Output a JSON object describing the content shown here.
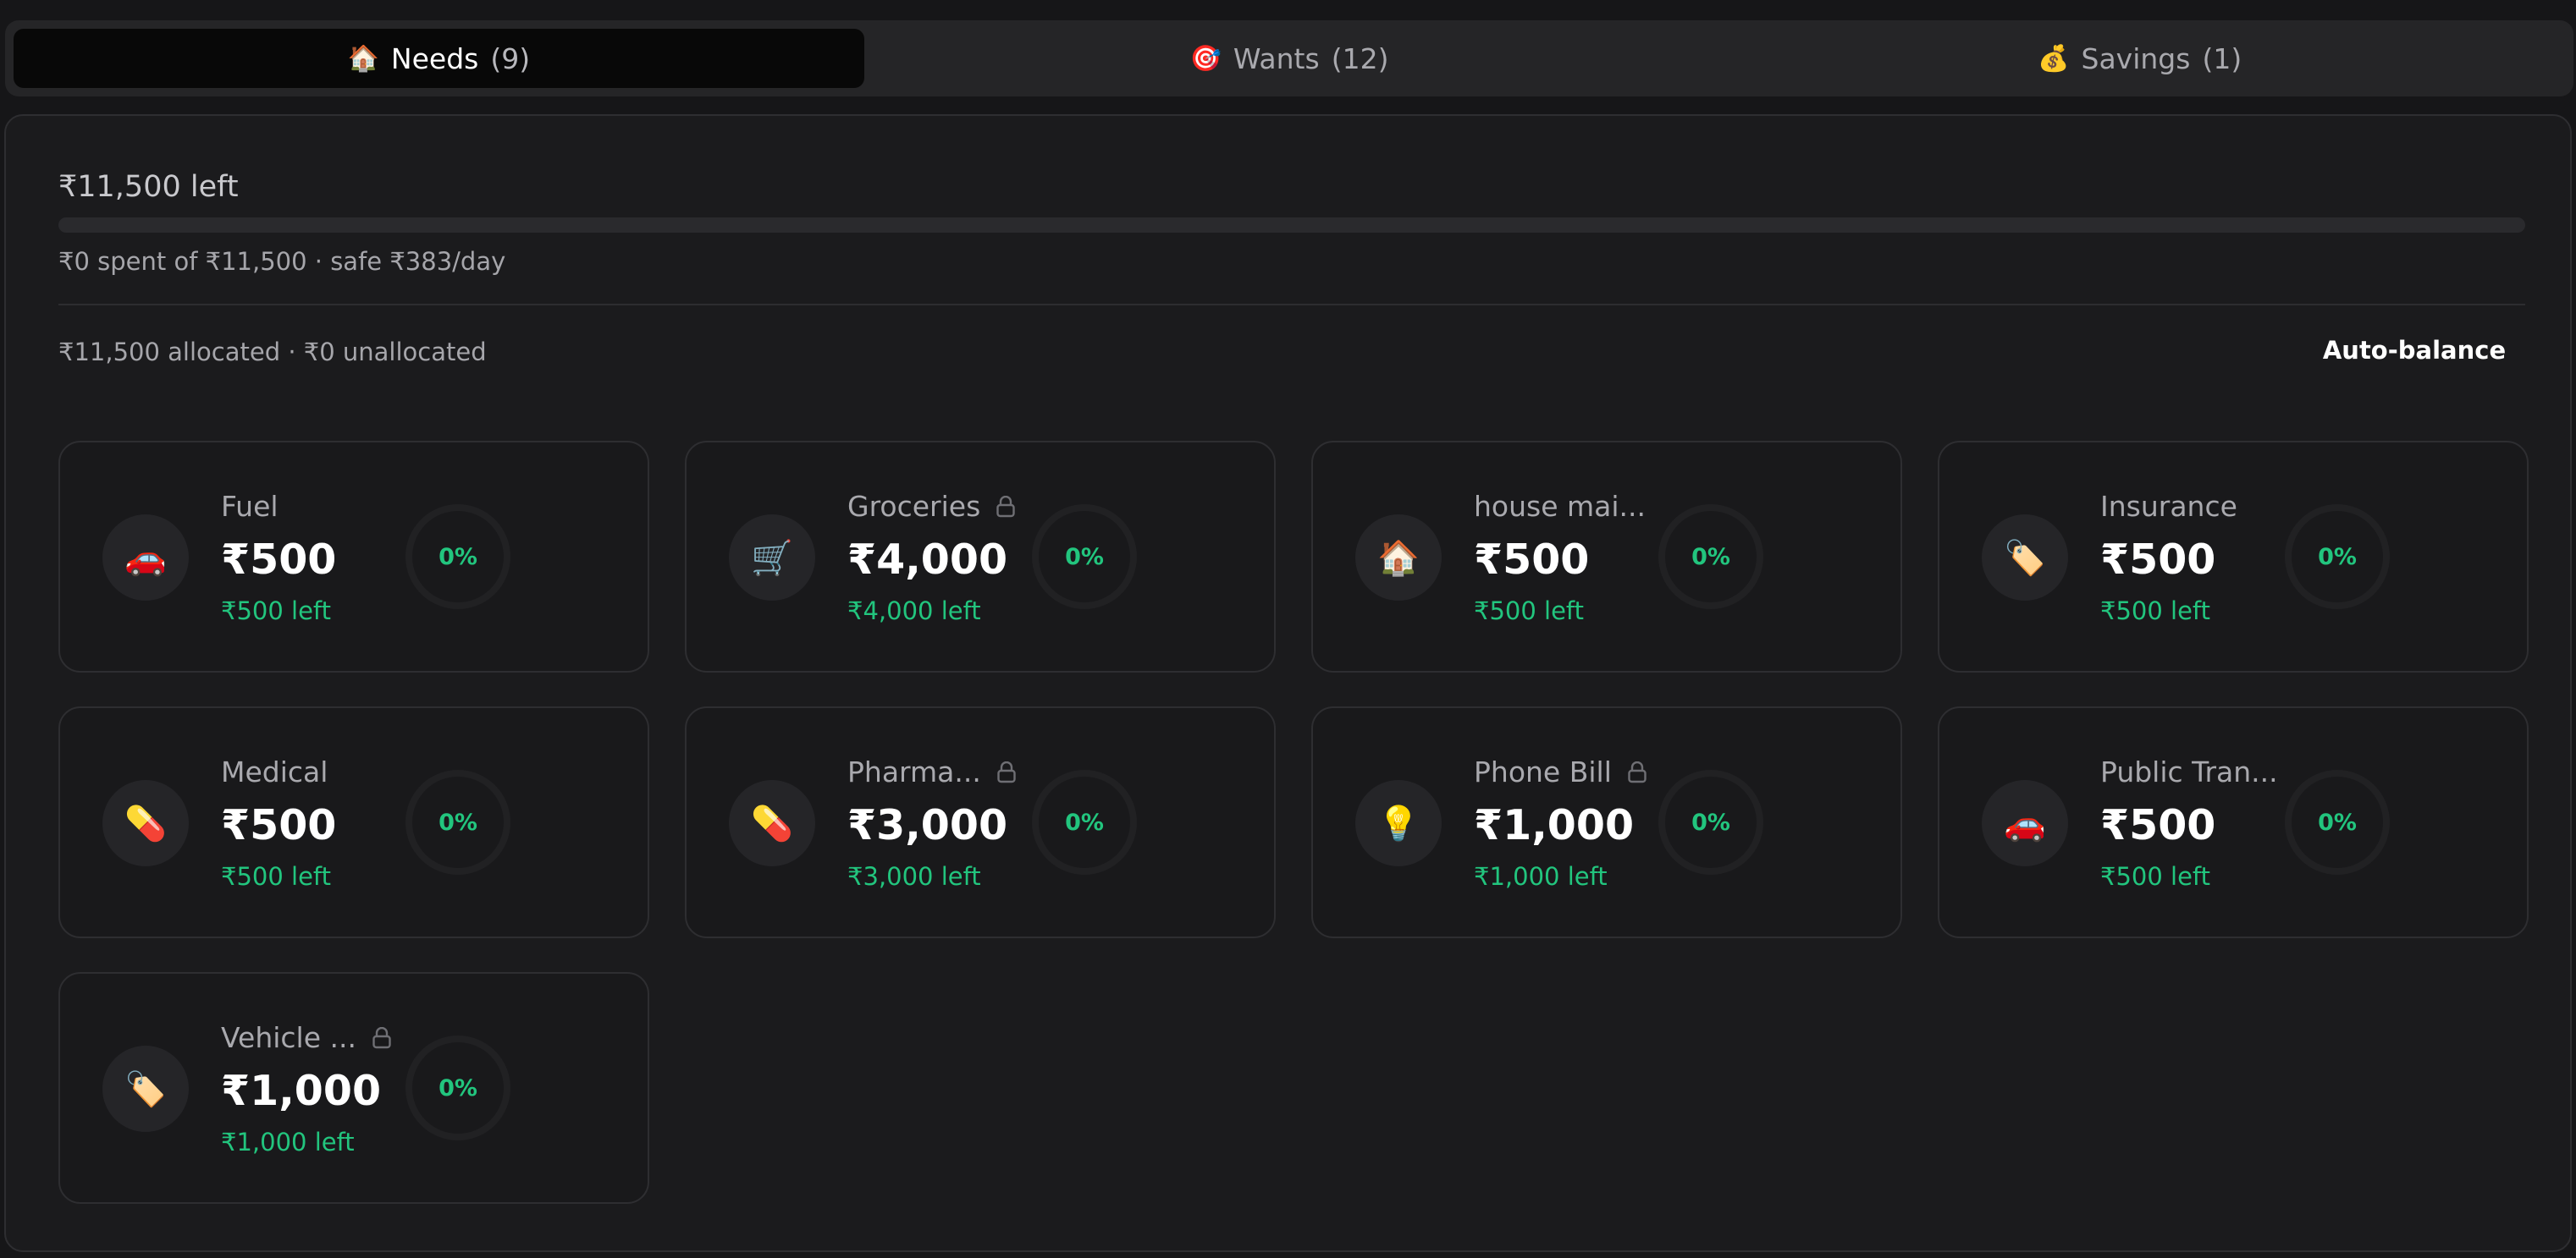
{
  "tabs": [
    {
      "icon": "🏠",
      "label": "Needs",
      "count": "(9)",
      "active": true
    },
    {
      "icon": "🎯",
      "label": "Wants",
      "count": "(12)",
      "active": false
    },
    {
      "icon": "💰",
      "label": "Savings",
      "count": "(1)",
      "active": false
    }
  ],
  "summary": {
    "left_title": "₹11,500 left",
    "spent_line": "₹0 spent of ₹11,500 · safe ₹383/day",
    "spent_fraction": 0,
    "alloc_line": "₹11,500 allocated · ₹0 unallocated",
    "auto_balance_label": "Auto-balance"
  },
  "colors": {
    "accent": "#22c57e",
    "background": "#161618",
    "card": "#19191b"
  },
  "cards": [
    {
      "icon": "🚗",
      "icon_name": "car-icon",
      "name": "Fuel",
      "locked": false,
      "amount": "₹500",
      "left": "₹500 left",
      "percent": "0%"
    },
    {
      "icon": "🛒",
      "icon_name": "cart-icon",
      "name": "Groceries",
      "locked": true,
      "amount": "₹4,000",
      "left": "₹4,000 left",
      "percent": "0%"
    },
    {
      "icon": "🏠",
      "icon_name": "house-icon",
      "name": "house mai...",
      "locked": false,
      "amount": "₹500",
      "left": "₹500 left",
      "percent": "0%"
    },
    {
      "icon": "🏷️",
      "icon_name": "tag-icon",
      "name": "Insurance",
      "locked": false,
      "amount": "₹500",
      "left": "₹500 left",
      "percent": "0%"
    },
    {
      "icon": "💊",
      "icon_name": "pill-icon",
      "name": "Medical",
      "locked": false,
      "amount": "₹500",
      "left": "₹500 left",
      "percent": "0%"
    },
    {
      "icon": "💊",
      "icon_name": "pill-icon",
      "name": "Pharma...",
      "locked": true,
      "amount": "₹3,000",
      "left": "₹3,000 left",
      "percent": "0%"
    },
    {
      "icon": "💡",
      "icon_name": "lightbulb-icon",
      "name": "Phone Bill",
      "locked": true,
      "amount": "₹1,000",
      "left": "₹1,000 left",
      "percent": "0%"
    },
    {
      "icon": "🚗",
      "icon_name": "car-icon",
      "name": "Public Tran...",
      "locked": false,
      "amount": "₹500",
      "left": "₹500 left",
      "percent": "0%"
    },
    {
      "icon": "🏷️",
      "icon_name": "tag-icon",
      "name": "Vehicle ...",
      "locked": true,
      "amount": "₹1,000",
      "left": "₹1,000 left",
      "percent": "0%"
    }
  ]
}
